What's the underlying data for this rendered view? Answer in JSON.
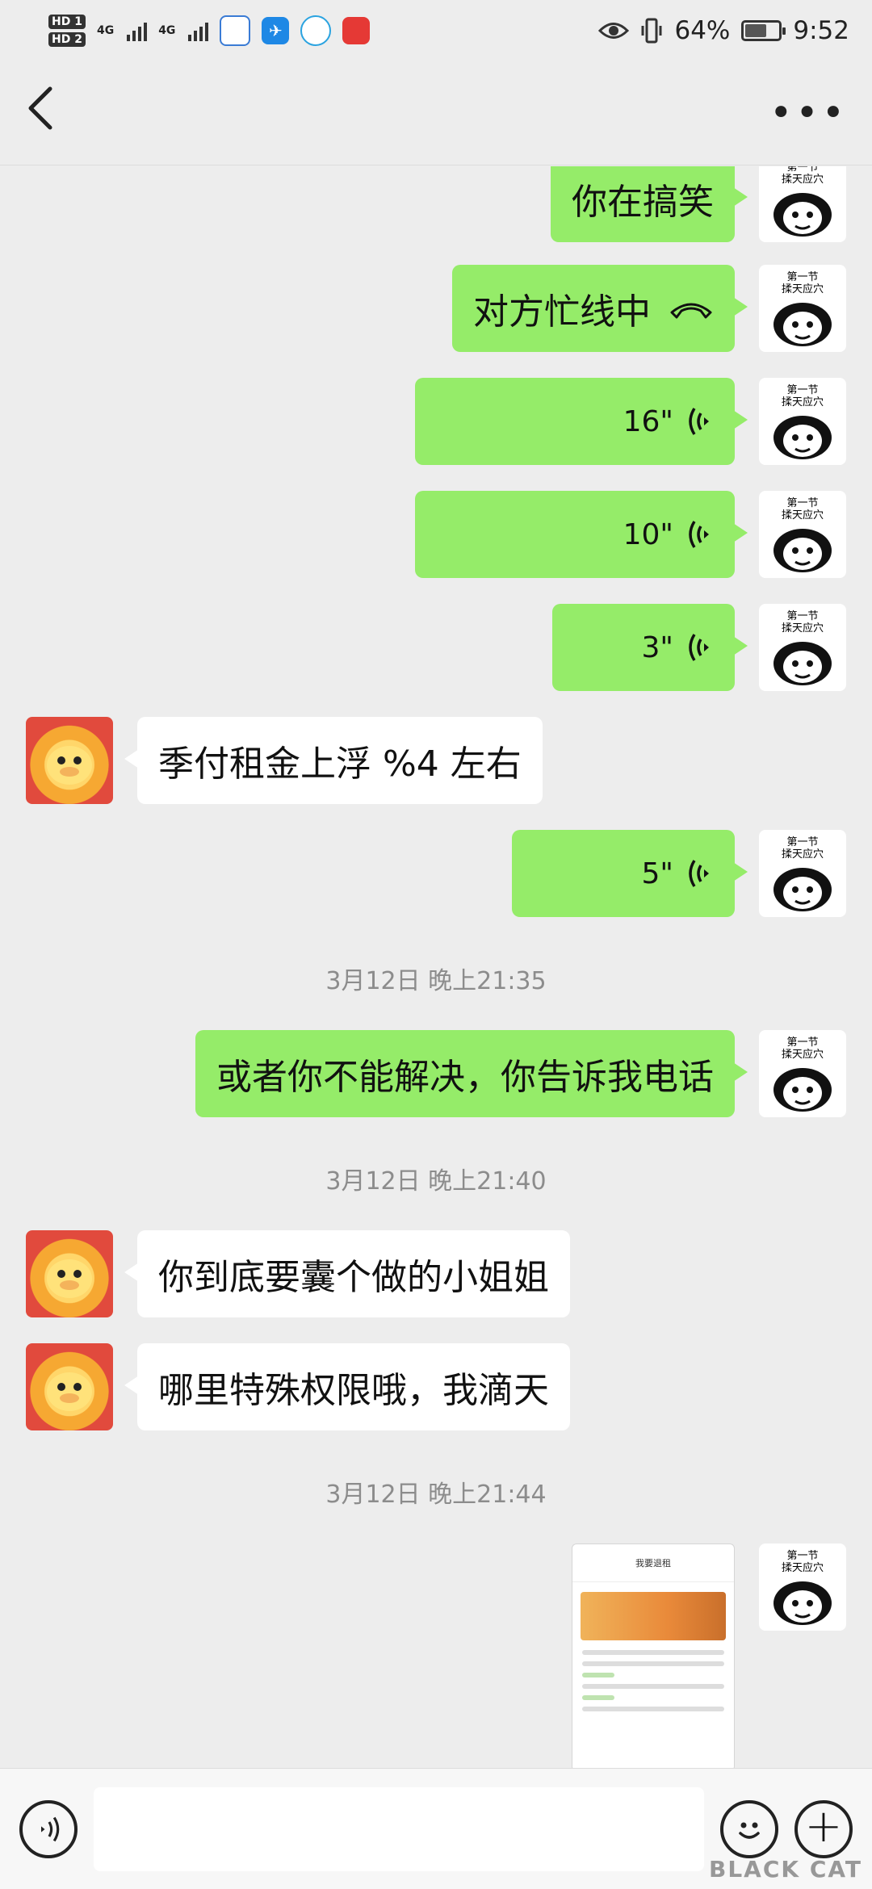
{
  "status_bar": {
    "sim1": "HD 1",
    "sim2": "HD 2",
    "net1": "4G",
    "net2": "4G",
    "battery_percent": "64%",
    "battery_level": 0.64,
    "time": "9:52"
  },
  "nav": {
    "back_icon": "chevron-left-icon",
    "more_icon": "more-dots-icon",
    "more_glyph": "•••"
  },
  "avatars": {
    "me_caption_1": "第一节",
    "me_caption_2": "揉天应穴"
  },
  "messages": [
    {
      "side": "me",
      "type": "text",
      "text": "你在搞笑"
    },
    {
      "side": "me",
      "type": "call",
      "text": "对方忙线中"
    },
    {
      "side": "me",
      "type": "voice",
      "text": "16\""
    },
    {
      "side": "me",
      "type": "voice",
      "text": "10\""
    },
    {
      "side": "me",
      "type": "voice",
      "text": "3\""
    },
    {
      "side": "other",
      "type": "text",
      "text": "季付租金上浮 %4 左右"
    },
    {
      "side": "me",
      "type": "voice",
      "text": "5\""
    },
    {
      "type": "time",
      "text": "3月12日 晚上21:35"
    },
    {
      "side": "me",
      "type": "text",
      "text": "或者你不能解决，你告诉我电话"
    },
    {
      "type": "time",
      "text": "3月12日 晚上21:40"
    },
    {
      "side": "other",
      "type": "text",
      "text": "你到底要囊个做的小姐姐"
    },
    {
      "side": "other",
      "type": "text",
      "text": "哪里特殊权限哦，我滴天"
    },
    {
      "type": "time",
      "text": "3月12日 晚上21:44"
    },
    {
      "side": "me",
      "type": "image",
      "text": "我要退租"
    }
  ],
  "input_bar": {
    "voice_icon": "voice-input-icon",
    "emoji_icon": "emoji-icon",
    "plus_icon": "plus-icon",
    "plus_glyph": "+",
    "input_value": ""
  },
  "watermark": "BLACK CAT"
}
